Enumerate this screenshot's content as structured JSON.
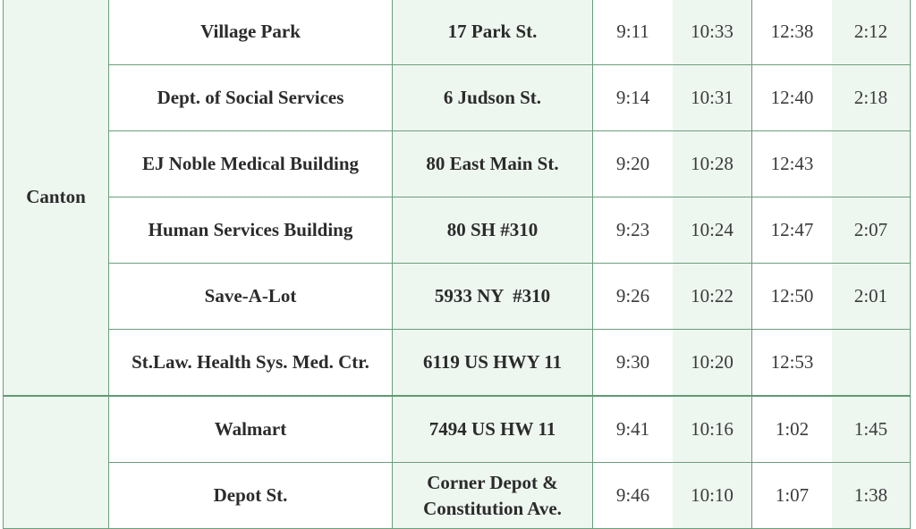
{
  "schedule": {
    "groups": [
      {
        "city": "Canton",
        "stops": [
          {
            "name": "Village Park",
            "address": "17 Park St.",
            "times": [
              "9:11",
              "10:33",
              "12:38",
              "2:12"
            ]
          },
          {
            "name": "Dept. of Social Services",
            "address": "6 Judson St.",
            "times": [
              "9:14",
              "10:31",
              "12:40",
              "2:18"
            ]
          },
          {
            "name": "EJ Noble Medical Building",
            "address": "80 East Main St.",
            "times": [
              "9:20",
              "10:28",
              "12:43",
              ""
            ]
          },
          {
            "name": "Human Services Building",
            "address": "80 SH #310",
            "times": [
              "9:23",
              "10:24",
              "12:47",
              "2:07"
            ]
          },
          {
            "name": "Save-A-Lot",
            "address": "5933 NY  #310",
            "times": [
              "9:26",
              "10:22",
              "12:50",
              "2:01"
            ]
          },
          {
            "name": "St.Law. Health Sys. Med. Ctr.",
            "address": "6119 US HWY 11",
            "times": [
              "9:30",
              "10:20",
              "12:53",
              ""
            ]
          }
        ]
      },
      {
        "city": "",
        "stops": [
          {
            "name": "Walmart",
            "address": "7494 US HW 11",
            "times": [
              "9:41",
              "10:16",
              "1:02",
              "1:45"
            ]
          },
          {
            "name": "Depot St.",
            "address_lines": [
              "Corner Depot &",
              "Constitution Ave."
            ],
            "times": [
              "9:46",
              "10:10",
              "1:07",
              "1:38"
            ]
          }
        ]
      }
    ]
  },
  "colors": {
    "border": "#6a9f7b",
    "shade": "#eef6f0",
    "text": "#2b2b2b"
  }
}
